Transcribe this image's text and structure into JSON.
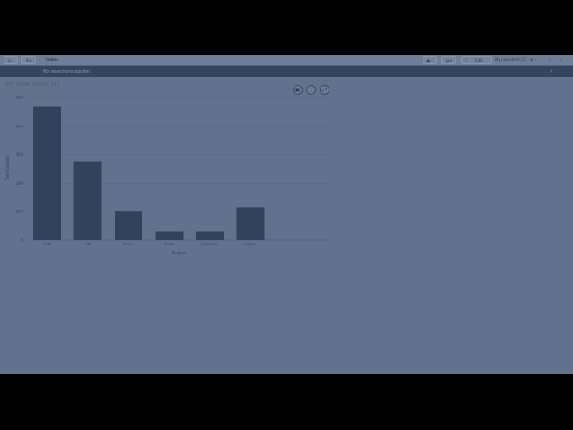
{
  "toolbar": {
    "left_icon": "compass-icon",
    "list_icon": "list-icon",
    "app_name": "Sales",
    "dropdown_icon": "chevron-down-icon",
    "edit_label": "Edit",
    "sheet_name": "My new sheet (1)"
  },
  "selection_bar": {
    "message": "No selections applied"
  },
  "sheet": {
    "title": "My new sheet (1)"
  },
  "chart_data": {
    "type": "bar",
    "categories": [
      "USA",
      "UK",
      "France",
      "Spain",
      "Germany",
      "Japan"
    ],
    "values": [
      47,
      27.5,
      10,
      3,
      3,
      11.5
    ],
    "xlabel": "Region",
    "ylabel": "Sum(Sales)",
    "ylim": [
      0,
      50
    ],
    "yticks": [
      "0",
      "10M",
      "20M",
      "30M",
      "40M",
      "50M"
    ],
    "bar_color": "#33425c",
    "grid": true
  }
}
